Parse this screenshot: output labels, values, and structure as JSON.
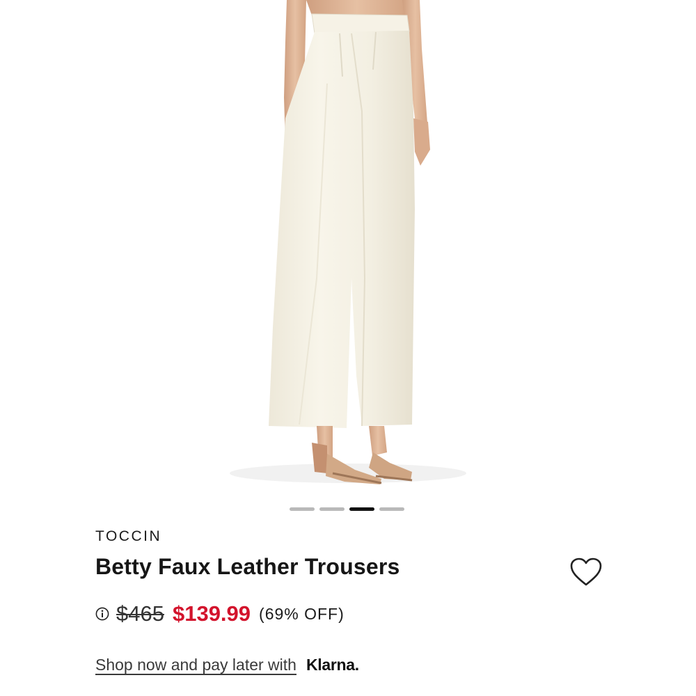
{
  "product": {
    "brand": "TOCCIN",
    "title": "Betty Faux Leather Trousers",
    "original_price": "$465",
    "sale_price": "$139.99",
    "discount": "(69% OFF)"
  },
  "gallery": {
    "image_alt": "model wearing wide-leg cream trousers with nude heeled sandals",
    "image_count": 4,
    "active_index": 3
  },
  "payment": {
    "link_text": "Shop now and pay later with",
    "provider": "Klarna."
  },
  "icons": {
    "info": "info-icon",
    "wishlist": "heart-icon"
  },
  "colors": {
    "sale": "#d3132c",
    "trousers": "#f4f0e3",
    "skin": "#e0b79a",
    "sandal": "#d2a987"
  }
}
